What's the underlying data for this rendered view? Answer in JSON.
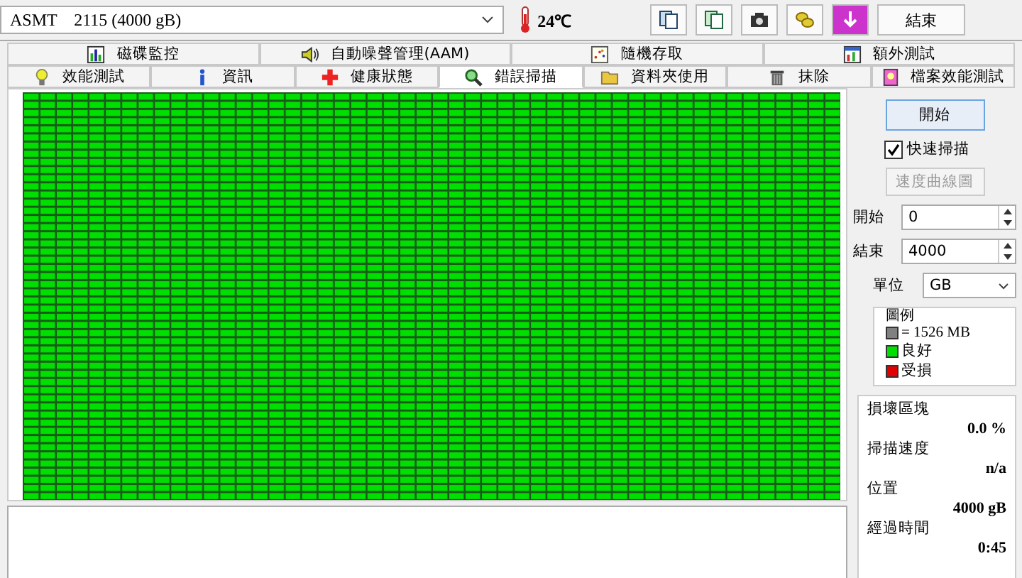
{
  "drive_select": {
    "value": "ASMT    2115 (4000 gB)"
  },
  "temperature": "24℃",
  "exit_button": "結束",
  "tabs_top": [
    {
      "label": "磁碟監控",
      "selected": false
    },
    {
      "label": "自動噪聲管理(AAM)",
      "selected": false
    },
    {
      "label": "隨機存取",
      "selected": false
    },
    {
      "label": "額外測試",
      "selected": false
    }
  ],
  "tabs_bottom": [
    {
      "label": "效能測試",
      "selected": false
    },
    {
      "label": "資訊",
      "selected": false
    },
    {
      "label": "健康狀態",
      "selected": false
    },
    {
      "label": "錯誤掃描",
      "selected": true
    },
    {
      "label": "資料夾使用",
      "selected": false
    },
    {
      "label": "抹除",
      "selected": false
    },
    {
      "label": "檔案效能測試",
      "selected": false
    }
  ],
  "start_button": "開始",
  "quick_scan": {
    "label": "快速掃描",
    "checked": true
  },
  "speed_map_button": {
    "label": "速度曲線圖",
    "disabled": true
  },
  "range_fields": [
    {
      "label": "開始",
      "value": "0"
    },
    {
      "label": "結束",
      "value": "4000"
    }
  ],
  "unit": {
    "label": "單位",
    "value": "GB"
  },
  "legend": {
    "title": "圖例",
    "items": [
      {
        "label": "= 1526 MB",
        "color": "#808080"
      },
      {
        "label": "良好",
        "color": "#00e000"
      },
      {
        "label": "受損",
        "color": "#e00000"
      }
    ]
  },
  "stats": [
    {
      "label": "損壞區塊",
      "value": "0.0 %"
    },
    {
      "label": "掃描速度",
      "value": "n/a"
    },
    {
      "label": "位置",
      "value": "4000 gB"
    },
    {
      "label": "經過時間",
      "value": "0:45"
    }
  ]
}
